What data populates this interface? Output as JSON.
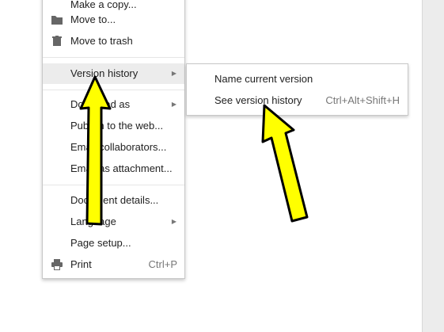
{
  "menu": {
    "items": [
      {
        "label": "Make a copy...",
        "icon": "copy-icon"
      },
      {
        "label": "Move to...",
        "icon": "folder-icon"
      },
      {
        "label": "Move to trash",
        "icon": "trash-icon"
      },
      {
        "label": "Version history",
        "submenu": true
      },
      {
        "label": "Download as",
        "submenu": true
      },
      {
        "label": "Publish to the web..."
      },
      {
        "label": "Email collaborators..."
      },
      {
        "label": "Email as attachment..."
      },
      {
        "label": "Document details..."
      },
      {
        "label": "Language",
        "submenu": true
      },
      {
        "label": "Page setup..."
      },
      {
        "label": "Print",
        "shortcut": "Ctrl+P",
        "icon": "printer-icon"
      }
    ]
  },
  "submenu": {
    "items": [
      {
        "label": "Name current version"
      },
      {
        "label": "See version history",
        "shortcut": "Ctrl+Alt+Shift+H"
      }
    ]
  },
  "annotations": {
    "arrow_color": "#ffff00",
    "outline_color": "#000000"
  }
}
